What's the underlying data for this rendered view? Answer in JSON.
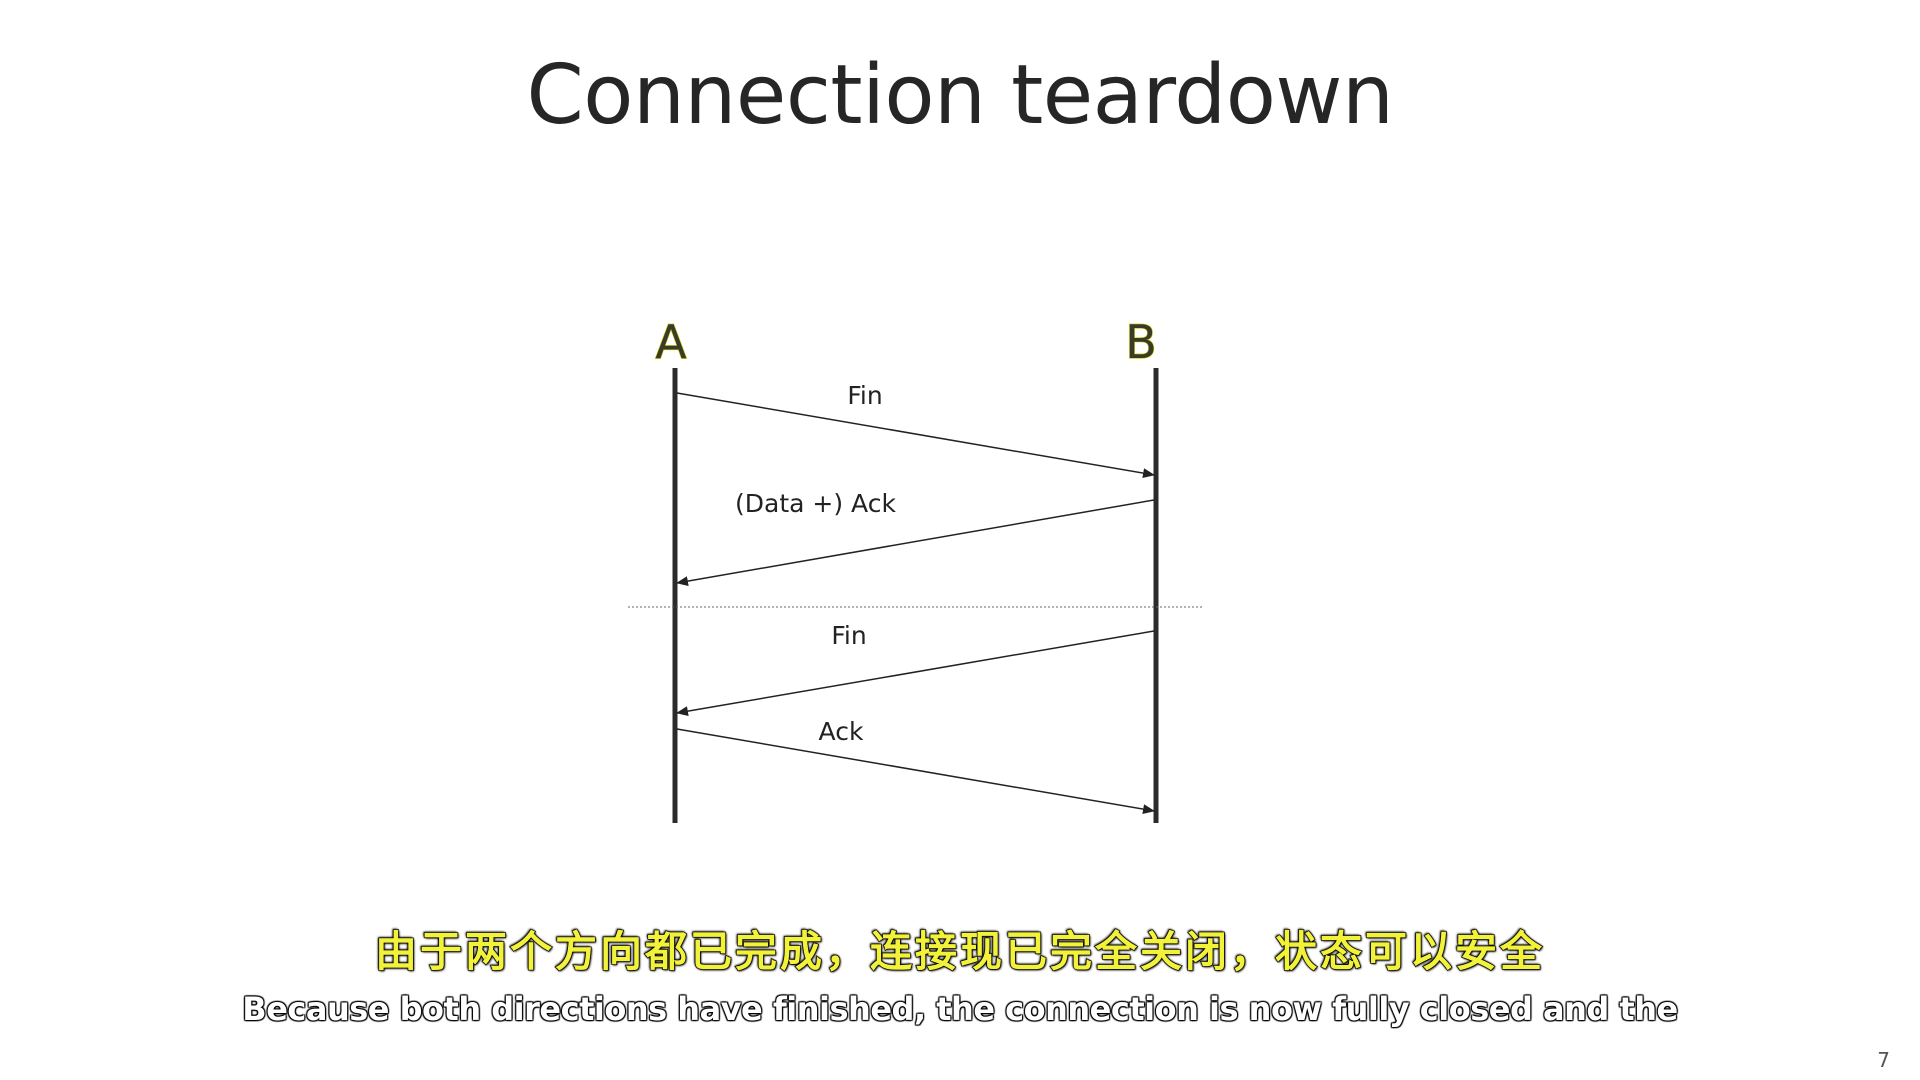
{
  "slide": {
    "title": "Connection teardown",
    "page_number": "7"
  },
  "diagram": {
    "nodes": {
      "a": "A",
      "b": "B"
    },
    "messages": {
      "fin_1": "Fin",
      "data_ack": "(Data +) Ack",
      "fin_2": "Fin",
      "ack": "Ack"
    }
  },
  "subtitles": {
    "zh": "由于两个方向都已完成，连接现已完全关闭，状态可以安全",
    "en": "Because both directions have finished, the connection is now fully closed and the"
  }
}
